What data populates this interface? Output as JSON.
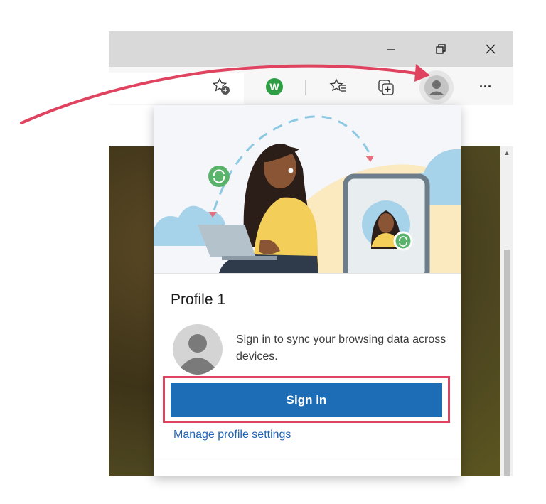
{
  "window": {
    "minimize_icon": "minimize-icon",
    "restore_icon": "restore-icon",
    "close_icon": "close-icon"
  },
  "toolbar": {
    "icons": [
      "add-favorite-icon",
      "extension-icon",
      "favorites-icon",
      "collections-icon",
      "profile-avatar-icon",
      "more-icon"
    ],
    "extension_letter": "W",
    "more_label": "···"
  },
  "profile_flyout": {
    "title": "Profile 1",
    "sync_message": "Sign in to sync your browsing data across devices.",
    "sign_in_label": "Sign in",
    "manage_link": "Manage profile settings"
  },
  "colors": {
    "accent": "#1d6db6",
    "highlight": "#e0435f",
    "link": "#2063b5"
  }
}
